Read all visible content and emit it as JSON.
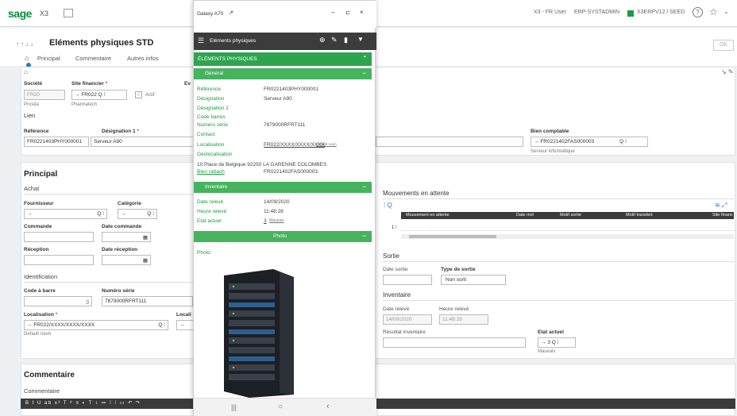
{
  "topbar": {
    "logo": "sage",
    "product": "X3",
    "user": "X3 - FR User",
    "role": "ERP-SYSTADMIN",
    "folder": "X3ERPV12 / SEED"
  },
  "page": {
    "title": "Eléments physiques STD",
    "tabs": [
      "Principal",
      "Commentaire",
      "Autres infos"
    ],
    "ok_label": "OK"
  },
  "header": {
    "societe_label": "Société",
    "societe_value": "FR20",
    "societe_sub": "Proséa",
    "site_label": "Site financier",
    "site_value": "FR022",
    "site_sub": "Pharmatech",
    "actif_label": "Actif",
    "ev_label": "Ev",
    "lien_label": "Lien",
    "reference_label": "Référence",
    "reference_value": "FR0221403PHY000001",
    "designation_label": "Désignation 1",
    "designation_value": "Serveur A90",
    "bien_label": "Bien comptable",
    "bien_value": "FR0221402FAS000003",
    "bien_sub": "Serveur informatique"
  },
  "principal": {
    "title": "Principal",
    "achat": "Achat",
    "fournisseur_label": "Fournisseur",
    "categorie_label": "Catégorie",
    "commande_label": "Commande",
    "date_commande_label": "Date commande",
    "reception_label": "Réception",
    "date_reception_label": "Date réception",
    "identification": "Identification",
    "code_barre_label": "Code à barre",
    "numero_serie_label": "Numéro série",
    "numero_serie_value": "7879000RFRT111",
    "localisation_label": "Localisation",
    "localisation_value": "FR022/XXXX/XXXX/XXXX",
    "localisation_sub": "Default room",
    "local_label": "Locali"
  },
  "mouvements": {
    "title": "Mouvements en attente",
    "columns": [
      "Mouvement en attente",
      "Date mvt",
      "Motif sortie",
      "Motif transfert",
      "Site financ"
    ],
    "row_number": "1"
  },
  "sortie": {
    "title": "Sortie",
    "date_label": "Date sortie",
    "type_label": "Type de sortie",
    "type_value": "Non sorti"
  },
  "inventaire": {
    "title": "Inventaire",
    "date_label": "Date relevé",
    "date_value": "14/09/2020",
    "heure_label": "Heure relevé",
    "heure_value": "11:48:28",
    "resultat_label": "Résultat inventaire",
    "etat_label": "Etat actuel",
    "etat_value": "3",
    "etat_sub": "Mauvais"
  },
  "commentaire": {
    "title": "Commentaire",
    "label": "Commentaire",
    "toolbar_glyphs": "B I U ab x² T ⁸ ≡ ◐ T ↕ ≔ ⁞ ⁞ ▭ ↶ ↷"
  },
  "phone": {
    "window_title": "Galaxy A70",
    "header_title": "Eléments physiques",
    "section": "ÉLÉMENTS PHYSIQUES",
    "general": "Général",
    "inventaire": "Inventaire",
    "photo": "Photo",
    "photo_label": "Photo",
    "rows": [
      {
        "k": "Référence",
        "v": "FR0221403PHY000001"
      },
      {
        "k": "Désignation",
        "v": "Serveur A90"
      },
      {
        "k": "Désignation 2",
        "v": ""
      },
      {
        "k": "Code barres",
        "v": ""
      },
      {
        "k": "Numéro série",
        "v": "7879000RFRT111"
      },
      {
        "k": "Contact",
        "v": ""
      },
      {
        "k": "Localisation",
        "v": "FR022/XXXX/XXXX/XXXX"
      },
      {
        "k": "Géolocalisation",
        "v": ""
      }
    ],
    "localisation_sub": "Default room",
    "address": "10 Place de Belgique 92250 LA GARENNE COLOMBES",
    "bien_label": "Bien rattach",
    "bien_value": "FR0221402FAS000003",
    "inv_rows": [
      {
        "k": "Date relevé",
        "v": "14/09/2020"
      },
      {
        "k": "Heure relevé",
        "v": "11:48:28"
      },
      {
        "k": "Etat actuel",
        "v": "3"
      }
    ],
    "etat_sub": "Mauvais"
  },
  "colors": {
    "green": "#2ea44f",
    "dark": "#3c3c3c",
    "brand": "#0a8c3c"
  }
}
